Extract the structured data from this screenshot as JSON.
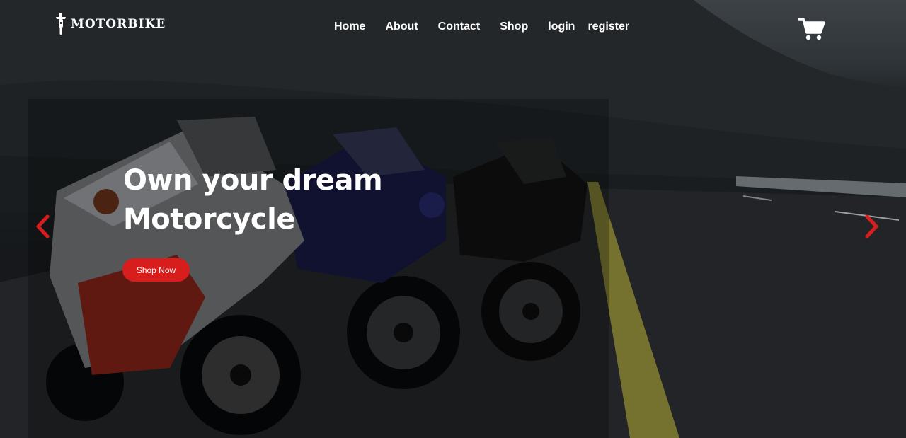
{
  "brand": {
    "name": "MOTORBIKE",
    "icon": "motorbike-logo-icon"
  },
  "nav": {
    "items": [
      "Home",
      "About",
      "Contact",
      "Shop",
      "login",
      "register"
    ]
  },
  "cart": {
    "icon": "shopping-cart-icon"
  },
  "hero": {
    "headline_line1": "Own your dream",
    "headline_line2": "Motorcycle",
    "cta_label": "Shop Now"
  },
  "carousel": {
    "prev_icon": "chevron-left-icon",
    "next_icon": "chevron-right-icon"
  },
  "colors": {
    "accent": "#d81d1d",
    "text": "#ffffff"
  }
}
